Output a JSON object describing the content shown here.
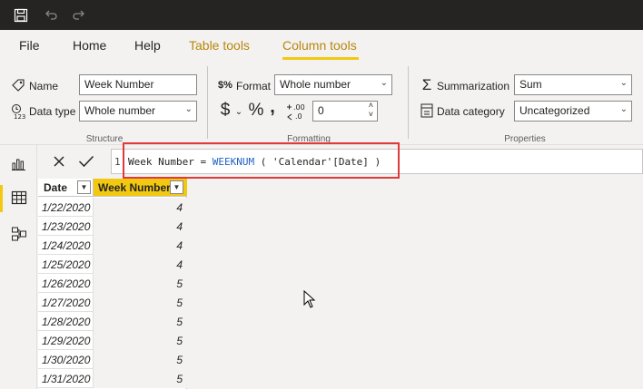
{
  "titlebar": {
    "icons": [
      "save-icon",
      "undo-icon",
      "redo-icon"
    ]
  },
  "tabs": [
    {
      "label": "File",
      "state": "normal"
    },
    {
      "label": "Home",
      "state": "normal"
    },
    {
      "label": "Help",
      "state": "normal"
    },
    {
      "label": "Table tools",
      "state": "contextual"
    },
    {
      "label": "Column tools",
      "state": "active"
    }
  ],
  "ribbon": {
    "structure": {
      "name_label": "Name",
      "name_value": "Week Number",
      "datatype_label": "Data type",
      "datatype_value": "Whole number",
      "group_label": "Structure"
    },
    "formatting": {
      "format_label": "Format",
      "format_value": "Whole number",
      "currency_symbol": "$",
      "percent_symbol": "%",
      "comma_symbol": ",",
      "decimal_places": "0",
      "group_label": "Formatting"
    },
    "properties": {
      "summarization_label": "Summarization",
      "summarization_value": "Sum",
      "category_label": "Data category",
      "category_value": "Uncategorized",
      "group_label": "Properties"
    }
  },
  "leftnav": {
    "items": [
      "report-view-icon",
      "data-view-icon",
      "model-view-icon"
    ],
    "active_index": 1
  },
  "formula": {
    "line_number": "1",
    "column_name": "Week Number",
    "operator": "=",
    "function": "WEEKNUM",
    "open_paren": "(",
    "argument": "'Calendar'[Date]",
    "close_paren": ")"
  },
  "table": {
    "columns": [
      "Date",
      "Week Number"
    ],
    "rows": [
      [
        "1/22/2020",
        "4"
      ],
      [
        "1/23/2020",
        "4"
      ],
      [
        "1/24/2020",
        "4"
      ],
      [
        "1/25/2020",
        "4"
      ],
      [
        "1/26/2020",
        "5"
      ],
      [
        "1/27/2020",
        "5"
      ],
      [
        "1/28/2020",
        "5"
      ],
      [
        "1/29/2020",
        "5"
      ],
      [
        "1/30/2020",
        "5"
      ],
      [
        "1/31/2020",
        "5"
      ]
    ]
  },
  "colors": {
    "accent": "#f2c811",
    "contextual_tab": "#b8860b",
    "highlight": "#e03a3a",
    "function": "#2262c6",
    "titlebar": "#252423"
  }
}
